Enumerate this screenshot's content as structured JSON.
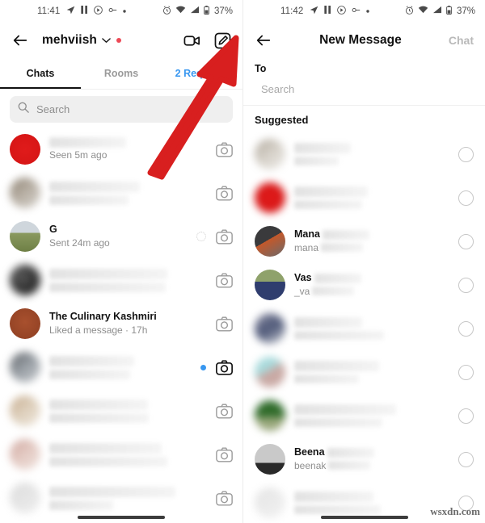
{
  "left_panel": {
    "statusbar": {
      "time": "11:41",
      "battery": "37%",
      "left_icons": [
        "navigation-icon",
        "pause-icon",
        "play-circle-icon",
        "link-icon",
        "dot-icon"
      ],
      "right_icons": [
        "alarm-icon",
        "wifi-icon",
        "signal-icon",
        "battery-icon"
      ]
    },
    "header": {
      "back_label": "back-arrow",
      "username": "mehviish",
      "chevron": "⌄",
      "video_icon": "video-camera-icon",
      "compose_icon": "compose-icon"
    },
    "tabs": [
      {
        "label": "Chats",
        "active": true
      },
      {
        "label": "Rooms",
        "active": false
      },
      {
        "label": "2 Requests",
        "active": false,
        "style": "link"
      }
    ],
    "search": {
      "placeholder": "Search",
      "icon": "search-icon"
    },
    "chats": [
      {
        "title": "",
        "subtitle": "Seen 5m ago",
        "blurred_title": true,
        "avatar": "red",
        "unread": false,
        "sending": false
      },
      {
        "title": "",
        "subtitle": "",
        "blurred_title": true,
        "avatar": "blurred",
        "unread": false,
        "sending": false
      },
      {
        "title": "G",
        "subtitle": "Sent 24m ago",
        "blurred_title": false,
        "avatar": "landscape",
        "unread": false,
        "sending": true
      },
      {
        "title": "",
        "subtitle": "",
        "blurred_title": true,
        "avatar": "dark",
        "unread": false,
        "sending": false
      },
      {
        "title": "The Culinary Kashmiri",
        "subtitle": "Liked a message · 17h",
        "blurred_title": false,
        "avatar": "rust",
        "unread": false,
        "sending": false
      },
      {
        "title": "",
        "subtitle": "",
        "blurred_title": true,
        "avatar": "grey",
        "unread": true,
        "sending": false
      },
      {
        "title": "",
        "subtitle": "",
        "blurred_title": true,
        "avatar": "tan",
        "unread": false,
        "sending": false
      },
      {
        "title": "",
        "subtitle": "",
        "blurred_title": true,
        "avatar": "pale",
        "unread": false,
        "sending": false
      },
      {
        "title": "",
        "subtitle": "",
        "blurred_title": true,
        "avatar": "light",
        "unread": false,
        "sending": false
      }
    ]
  },
  "right_panel": {
    "statusbar": {
      "time": "11:42",
      "battery": "37%"
    },
    "header": {
      "back_label": "back-arrow",
      "title": "New Message",
      "action_label": "Chat"
    },
    "to_label": "To",
    "to_placeholder": "Search",
    "section_title": "Suggested",
    "suggested": [
      {
        "name": "",
        "handle": "",
        "blurred": true,
        "avatar": "person1"
      },
      {
        "name": "",
        "handle": "",
        "blurred": true,
        "avatar": "red"
      },
      {
        "name": "Mana",
        "handle": "mana",
        "blurred": false,
        "avatar": "person2"
      },
      {
        "name": "Vas",
        "handle": "_va",
        "blurred": false,
        "avatar": "person3"
      },
      {
        "name": "",
        "handle": "",
        "blurred": true,
        "avatar": "person4"
      },
      {
        "name": "",
        "handle": "",
        "blurred": true,
        "avatar": "person5"
      },
      {
        "name": "",
        "handle": "",
        "blurred": true,
        "avatar": "garden"
      },
      {
        "name": "Beena",
        "handle": "beenak",
        "blurred": false,
        "avatar": "person6"
      },
      {
        "name": "",
        "handle": "",
        "blurred": true,
        "avatar": "person7"
      }
    ]
  },
  "annotation": {
    "arrow_color": "#d81f1f",
    "arrow_name": "red-pointer-arrow",
    "points_to": "compose-icon"
  },
  "watermark": "wsxdn.com"
}
